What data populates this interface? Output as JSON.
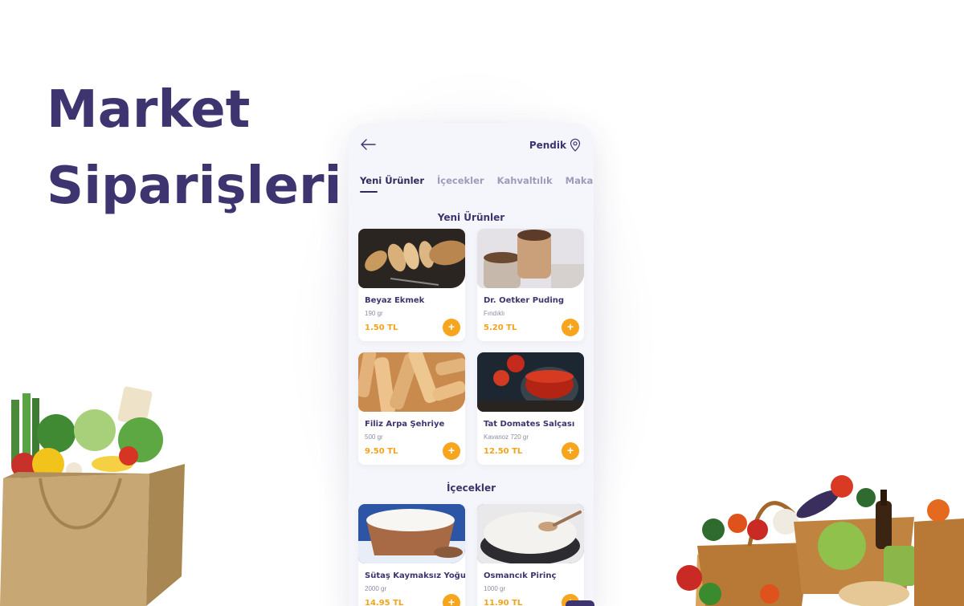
{
  "headline": {
    "line1": "Market",
    "line2": "Siparişleri"
  },
  "topbar": {
    "location": "Pendik"
  },
  "tabs": [
    {
      "label": "Yeni Ürünler",
      "active": true
    },
    {
      "label": "İçecekler",
      "active": false
    },
    {
      "label": "Kahvaltılık",
      "active": false
    },
    {
      "label": "Makarnala",
      "active": false
    }
  ],
  "sections": [
    {
      "title": "Yeni Ürünler",
      "products": [
        {
          "name": "Beyaz Ekmek",
          "detail": "190 gr",
          "price": "1.50 TL",
          "image": "bread"
        },
        {
          "name": "Dr. Oetker Puding",
          "detail": "Fındıklı",
          "price": "5.20 TL",
          "image": "pudding"
        },
        {
          "name": "Filiz Arpa Şehriye",
          "detail": "500 gr",
          "price": "9.50 TL",
          "image": "pasta"
        },
        {
          "name": "Tat Domates Salçası",
          "detail": "Kavanoz 720 gr",
          "price": "12.50 TL",
          "image": "tomato-paste"
        }
      ]
    },
    {
      "title": "İçecekler",
      "products": [
        {
          "name": "Sütaş Kaymaksız Yoğurt",
          "detail": "2000 gr",
          "price": "14.95 TL",
          "image": "yogurt"
        },
        {
          "name": "Osmancık Pirinç",
          "detail": "1000 gr",
          "price": "11.90 TL",
          "image": "rice"
        }
      ]
    }
  ],
  "add_button_label": "+",
  "colors": {
    "brand": "#3d3470",
    "accent": "#f7a51c",
    "phone_bg": "#f5f6fb"
  },
  "icons": {
    "back": "arrow-left-icon",
    "location": "map-pin-icon"
  }
}
